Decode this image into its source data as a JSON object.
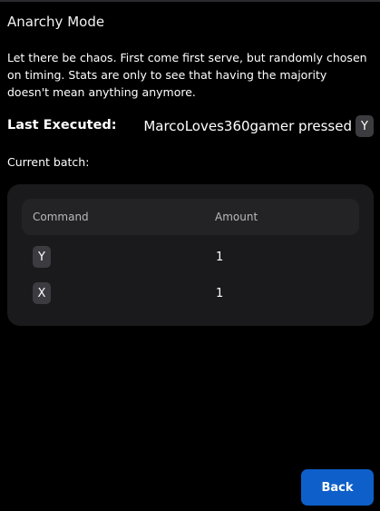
{
  "header": {
    "title": "Anarchy Mode"
  },
  "description": "Let there be chaos. First come first serve, but randomly chosen on timing. Stats are only to see that having the majority doesn't mean anything anymore.",
  "last_executed": {
    "label": "Last Executed:",
    "text": "MarcoLoves360gamer pressed",
    "key": "Y"
  },
  "batch": {
    "label": "Current batch:",
    "columns": [
      "Command",
      "Amount"
    ],
    "rows": [
      {
        "command": "Y",
        "amount": "1"
      },
      {
        "command": "X",
        "amount": "1"
      }
    ]
  },
  "footer": {
    "back_label": "Back"
  },
  "colors": {
    "background": "#000000",
    "panel": "#1a1a1c",
    "table_header": "#232326",
    "key_badge": "#3b3b40",
    "accent": "#0e5fc9"
  }
}
